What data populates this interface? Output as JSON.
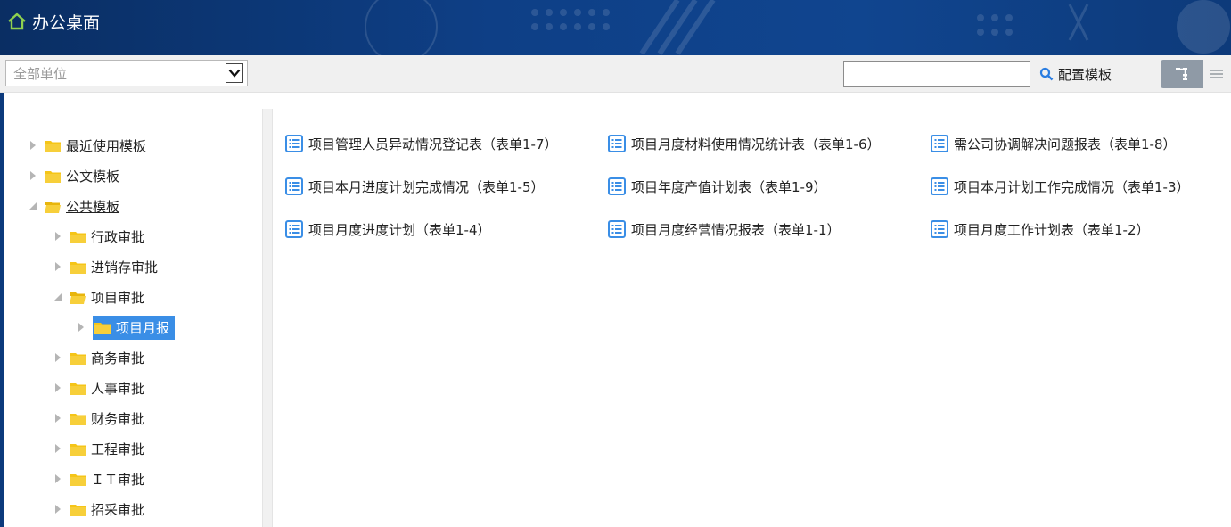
{
  "header": {
    "title": "办公桌面"
  },
  "toolbar": {
    "unit_select": {
      "selected": "全部单位"
    },
    "search": {
      "value": "",
      "placeholder": ""
    },
    "config_label": "配置模板"
  },
  "tree": {
    "items": [
      {
        "label": "最近使用模板",
        "level": 0,
        "state": "collapsed"
      },
      {
        "label": "公文模板",
        "level": 0,
        "state": "collapsed"
      },
      {
        "label": "公共模板",
        "level": 0,
        "state": "expanded"
      },
      {
        "label": "行政审批",
        "level": 1,
        "state": "collapsed"
      },
      {
        "label": "进销存审批",
        "level": 1,
        "state": "collapsed"
      },
      {
        "label": "项目审批",
        "level": 1,
        "state": "expanded"
      },
      {
        "label": "项目月报",
        "level": 2,
        "state": "selected"
      },
      {
        "label": "商务审批",
        "level": 1,
        "state": "collapsed"
      },
      {
        "label": "人事审批",
        "level": 1,
        "state": "collapsed"
      },
      {
        "label": "财务审批",
        "level": 1,
        "state": "collapsed"
      },
      {
        "label": "工程审批",
        "level": 1,
        "state": "collapsed"
      },
      {
        "label": "ＩＴ审批",
        "level": 1,
        "state": "collapsed"
      },
      {
        "label": "招采审批",
        "level": 1,
        "state": "collapsed"
      }
    ]
  },
  "forms": [
    {
      "label": "项目管理人员异动情况登记表（表单1-7）"
    },
    {
      "label": "项目月度材料使用情况统计表（表单1-6）"
    },
    {
      "label": "需公司协调解决问题报表（表单1-8）"
    },
    {
      "label": "项目本月进度计划完成情况（表单1-5）"
    },
    {
      "label": "项目年度产值计划表（表单1-9）"
    },
    {
      "label": "项目本月计划工作完成情况（表单1-3）"
    },
    {
      "label": "项目月度进度计划（表单1-4）"
    },
    {
      "label": "项目月度经营情况报表（表单1-1）"
    },
    {
      "label": "项目月度工作计划表（表单1-2）"
    }
  ],
  "colors": {
    "header_bg": "#0e3f86",
    "folder": "#f5c518",
    "selected_bg": "#3a8ee6",
    "form_icon": "#3a8ee6",
    "home_icon": "#8fd14f"
  }
}
